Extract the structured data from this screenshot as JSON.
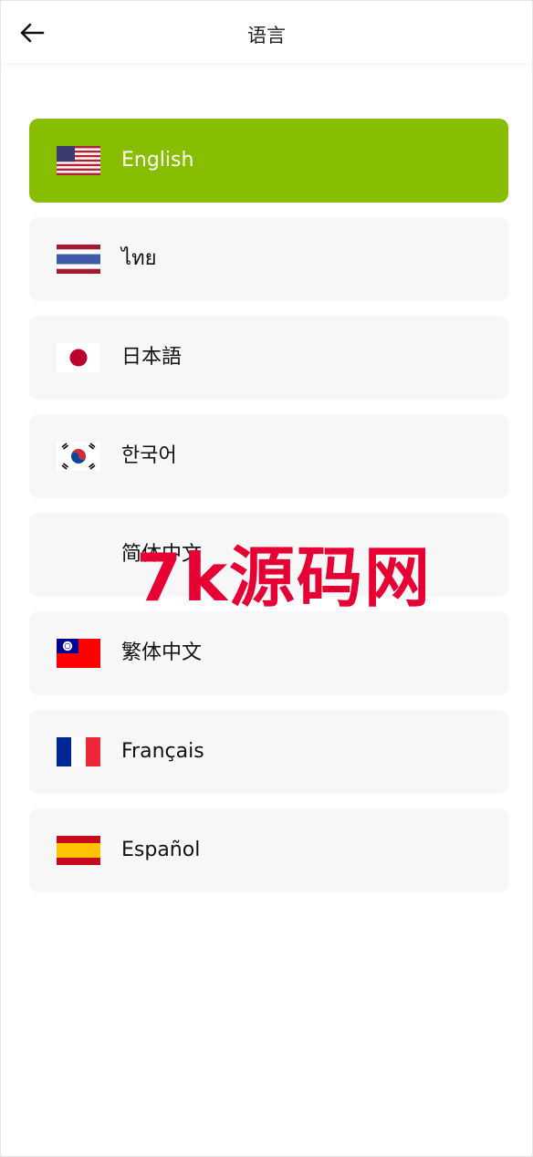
{
  "header": {
    "title": "语言",
    "back_icon": "arrow-left-icon"
  },
  "languages": [
    {
      "label": "English",
      "flag": "us-flag-icon",
      "selected": true
    },
    {
      "label": "ไทย",
      "flag": "thailand-flag-icon",
      "selected": false
    },
    {
      "label": "日本語",
      "flag": "japan-flag-icon",
      "selected": false
    },
    {
      "label": "한국어",
      "flag": "korea-flag-icon",
      "selected": false
    },
    {
      "label": "简体中文",
      "flag": "",
      "selected": false
    },
    {
      "label": "繁体中文",
      "flag": "taiwan-flag-icon",
      "selected": false
    },
    {
      "label": "Français",
      "flag": "france-flag-icon",
      "selected": false
    },
    {
      "label": "Español",
      "flag": "spain-flag-icon",
      "selected": false
    }
  ],
  "watermark": "7k源码网",
  "colors": {
    "accent": "#87bf00",
    "item_bg": "#f7f7f7",
    "watermark": "#e60033"
  }
}
